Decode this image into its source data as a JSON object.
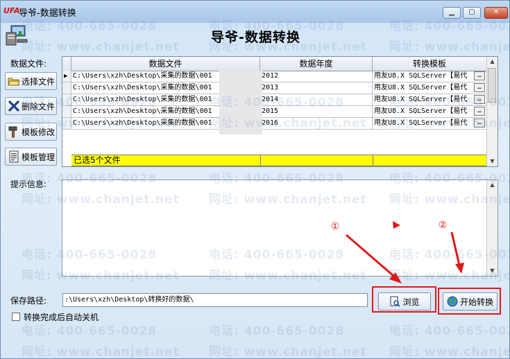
{
  "window": {
    "logo": "UFA",
    "title": "导爷-数据转换",
    "header_title": "导爷-数据转换"
  },
  "left": {
    "datafile_label": "数据文件:",
    "buttons": {
      "select": "选择文件",
      "delete": "删除文件",
      "tpl_edit": "模板修改",
      "tpl_mgr": "模板管理"
    },
    "tips_label": "提示信息:",
    "save_label": "保存路径:"
  },
  "grid": {
    "headers": [
      "数据文件",
      "数据年度",
      "转换模板"
    ],
    "rows": [
      {
        "file": "C:\\Users\\xzh\\Desktop\\采集的数据\\001",
        "year": "2012",
        "template": "用友U8.X SQLServer【易代"
      },
      {
        "file": "C:\\Users\\xzh\\Desktop\\采集的数据\\001",
        "year": "2013",
        "template": "用友U8.X SQLServer【易代"
      },
      {
        "file": "C:\\Users\\xzh\\Desktop\\采集的数据\\001",
        "year": "2014",
        "template": "用友U8.X SQLServer【易代"
      },
      {
        "file": "C:\\Users\\xzh\\Desktop\\采集的数据\\001",
        "year": "2015",
        "template": "用友U8.X SQLServer【易代"
      },
      {
        "file": "C:\\Users\\xzh\\Desktop\\采集的数据\\001",
        "year": "2016",
        "template": "用友U8.X SQLServer【易代"
      }
    ],
    "ellipsis": "…",
    "summary": "已选5个文件"
  },
  "save": {
    "path": ":\\Users\\xzh\\Desktop\\转换好的数据\\",
    "browse_label": "浏览",
    "start_label": "开始转换"
  },
  "options": {
    "auto_shutdown_label": "转换完成后自动关机",
    "auto_shutdown_checked": false
  },
  "annotations": {
    "marker_1": "①",
    "marker_2": "②",
    "color": "#e01818"
  },
  "watermark": {
    "phone": "电话: 400-665-0028",
    "site": "网址: www.chanjet.net"
  }
}
